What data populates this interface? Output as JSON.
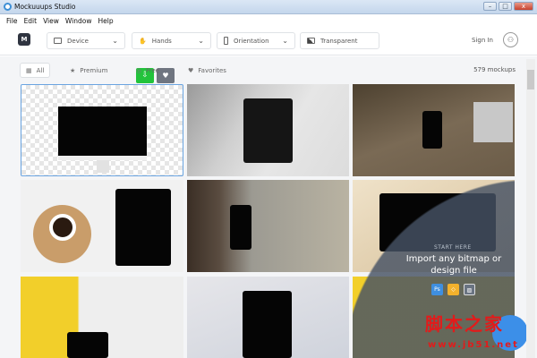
{
  "window": {
    "title": "Mockuuups Studio",
    "minimize": "–",
    "maximize": "□",
    "close": "x"
  },
  "menu": [
    "File",
    "Edit",
    "View",
    "Window",
    "Help"
  ],
  "toolbar": {
    "logo": "M",
    "device": "Device",
    "hands": "Hands",
    "orientation": "Orientation",
    "transparent": "Transparent",
    "sign_in": "Sign In"
  },
  "filters": {
    "all": "All",
    "premium": "Premium",
    "free": "Free",
    "favorites": "Favorites",
    "count": "579 mockups"
  },
  "overlay": {
    "kicker": "START HERE",
    "title": "Import any bitmap or design file",
    "formats": [
      "Ps",
      "Sketch",
      "Image"
    ]
  },
  "watermark": {
    "text": "脚本之家",
    "url": "www.jb51.net"
  },
  "colors": {
    "accent": "#3c8fe8",
    "download": "#22c33b"
  }
}
